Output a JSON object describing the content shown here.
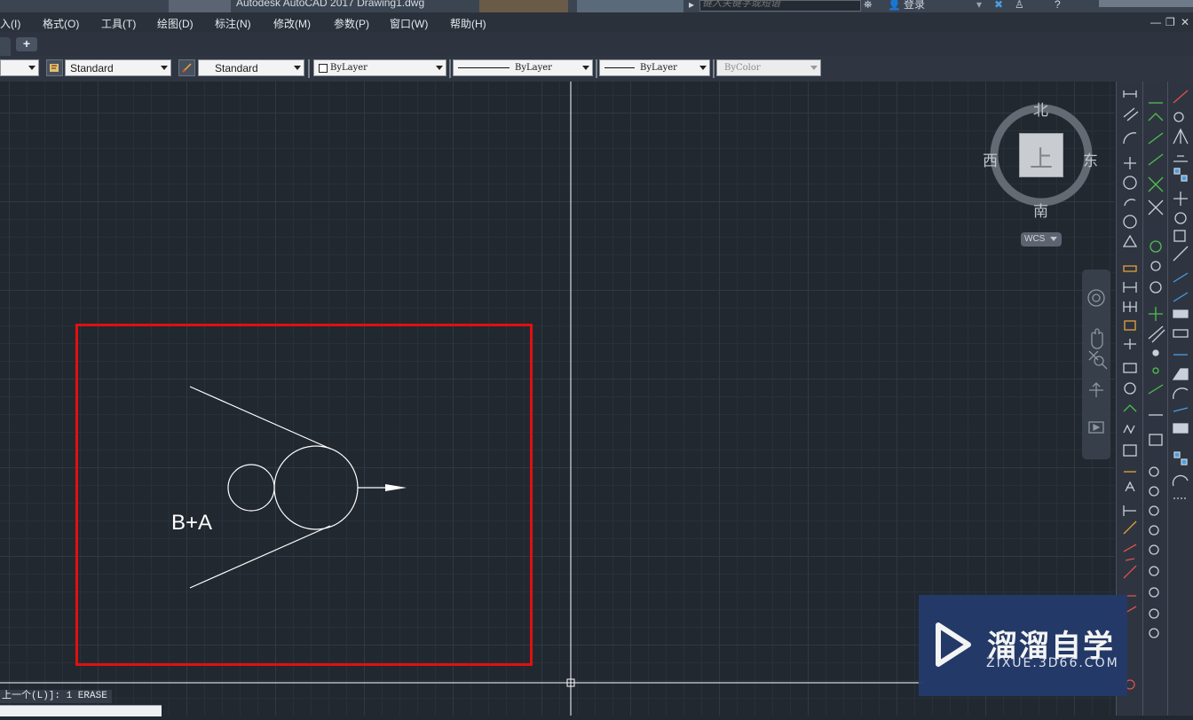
{
  "app": {
    "window_title": "Autodesk AutoCAD 2017    Drawing1.dwg",
    "search_placeholder": "键入关键字或短语",
    "login_label": "登录"
  },
  "menubar": {
    "items": [
      "入(I)",
      "格式(O)",
      "工具(T)",
      "绘图(D)",
      "标注(N)",
      "修改(M)",
      "参数(P)",
      "窗口(W)",
      "帮助(H)"
    ]
  },
  "tabs": {
    "add_label": "+"
  },
  "properties_toolbar": {
    "text_style": "Standard",
    "dim_style": "Standard",
    "color": "ByLayer",
    "linetype": "ByLayer",
    "lineweight": "ByLayer",
    "plot_style": "ByColor"
  },
  "viewcube": {
    "north": "北",
    "south": "南",
    "east": "东",
    "west": "西",
    "face": "上",
    "ucs_label": "WCS"
  },
  "drawing": {
    "annotation_text": "B+A",
    "selection_box_color": "#e01010",
    "line_color": "#ffffff",
    "background_color": "#212830"
  },
  "command_line": {
    "history": "上一个(L)]: 1 ERASE"
  },
  "watermark": {
    "title": "溜溜自学",
    "url": "ZIXUE.3D66.COM"
  }
}
